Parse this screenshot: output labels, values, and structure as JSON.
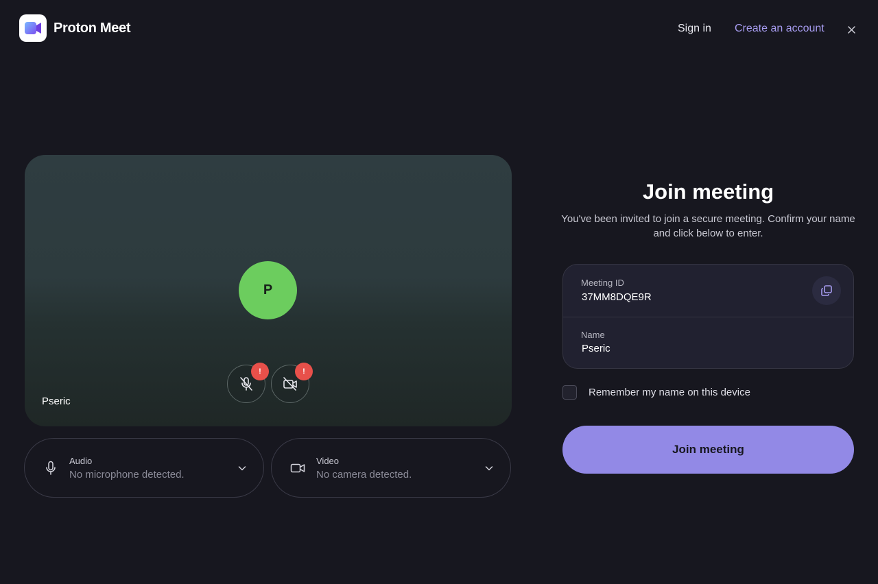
{
  "header": {
    "brand": "Proton Meet",
    "sign_in": "Sign in",
    "create_account": "Create an account",
    "close_icon": "close-icon"
  },
  "preview": {
    "avatar_initial": "P",
    "avatar_color": "#6ccd5e",
    "participant_name": "Pseric",
    "mic_warning": "!",
    "cam_warning": "!",
    "warning_color": "#e8504a"
  },
  "devices": {
    "audio": {
      "label": "Audio",
      "value": "No microphone detected.",
      "icon": "microphone-icon"
    },
    "video": {
      "label": "Video",
      "value": "No camera detected.",
      "icon": "camera-icon"
    }
  },
  "join": {
    "title": "Join meeting",
    "subtitle": "You've been invited to join a secure meeting. Confirm your name and click below to enter.",
    "meeting_id_label": "Meeting ID",
    "meeting_id": "37MM8DQE9R",
    "name_label": "Name",
    "name_value": "Pseric",
    "remember_label": "Remember my name on this device",
    "remember_checked": false,
    "button_label": "Join meeting",
    "accent_color": "#9289e6"
  }
}
